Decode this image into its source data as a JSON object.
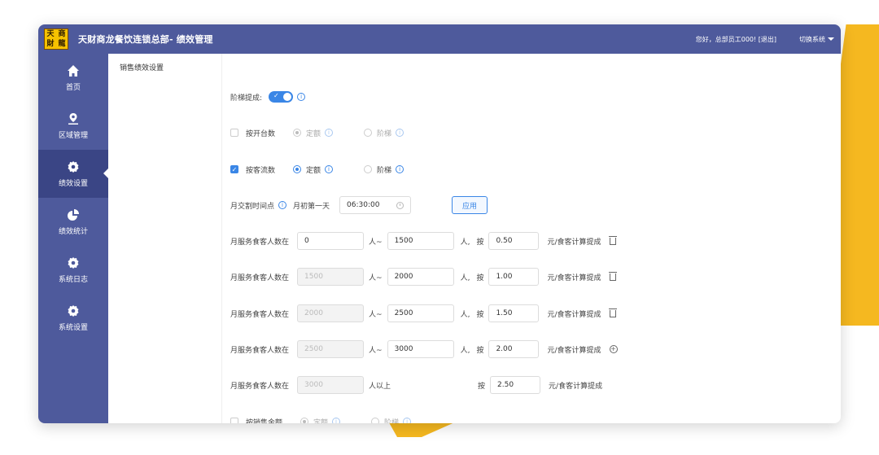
{
  "header": {
    "logo_chars": [
      "天",
      "商",
      "財",
      "龍"
    ],
    "title": "天财商龙餐饮连锁总部- 绩效管理",
    "greeting": "您好，总部员工000!  [退出]",
    "switch_system": "切换系统"
  },
  "sidebar": {
    "items": [
      {
        "label": "首页",
        "icon": "home-icon"
      },
      {
        "label": "区域管理",
        "icon": "location-pin-icon"
      },
      {
        "label": "绩效设置",
        "icon": "gear-icon",
        "active": true
      },
      {
        "label": "绩效统计",
        "icon": "pie-chart-icon"
      },
      {
        "label": "系统日志",
        "icon": "gear-icon"
      },
      {
        "label": "系统设置",
        "icon": "gear-icon"
      }
    ]
  },
  "subnav": {
    "item": "销售绩效设置"
  },
  "form": {
    "tier_commission_label": "阶梯提成:",
    "by_table_count": {
      "label": "按开台数",
      "opt_fixed": "定额",
      "opt_tier": "阶梯"
    },
    "by_guest_count": {
      "label": "按客流数",
      "opt_fixed": "定额",
      "opt_tier": "阶梯"
    },
    "month_cutoff": {
      "label": "月交割时间点",
      "day": "月初第一天",
      "time": "06:30:00",
      "apply": "应用"
    },
    "tiers": [
      {
        "label": "月服务食客人数在",
        "from": "0",
        "sep": "人~",
        "to": "1500",
        "unit": "人,",
        "by": "按",
        "rate": "0.50",
        "suffix": "元/食客计算提成",
        "action": "delete"
      },
      {
        "label": "月服务食客人数在",
        "from": "1500",
        "sep": "人~",
        "to": "2000",
        "unit": "人,",
        "by": "按",
        "rate": "1.00",
        "suffix": "元/食客计算提成",
        "action": "delete"
      },
      {
        "label": "月服务食客人数在",
        "from": "2000",
        "sep": "人~",
        "to": "2500",
        "unit": "人,",
        "by": "按",
        "rate": "1.50",
        "suffix": "元/食客计算提成",
        "action": "delete"
      },
      {
        "label": "月服务食客人数在",
        "from": "2500",
        "sep": "人~",
        "to": "3000",
        "unit": "人,",
        "by": "按",
        "rate": "2.00",
        "suffix": "元/食客计算提成",
        "action": "add"
      }
    ],
    "last_tier": {
      "label": "月服务食客人数在",
      "from": "3000",
      "sep": "人以上",
      "by": "按",
      "rate": "2.50",
      "suffix": "元/食客计算提成"
    },
    "by_sales_amount": {
      "label": "按销售金额",
      "opt_fixed": "定额",
      "opt_tier": "阶梯"
    }
  },
  "colors": {
    "brand": "#4e5a9c",
    "accent": "#3a86e6",
    "decor": "#f5b820"
  }
}
